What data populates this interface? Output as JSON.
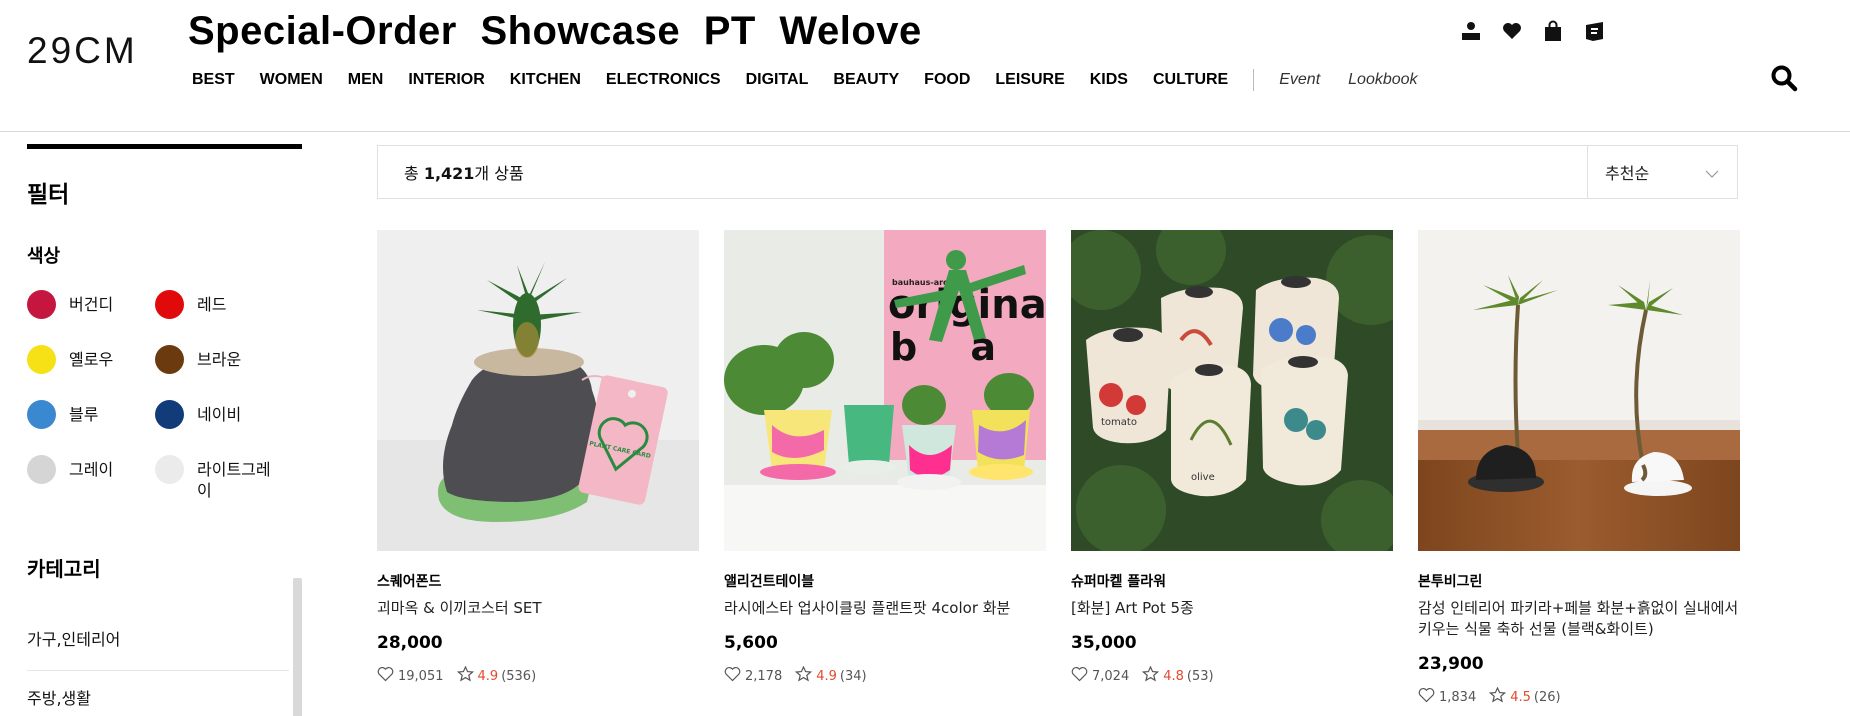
{
  "header": {
    "logo": "29CM",
    "headline": "Special-Order Showcase PT Welove",
    "nav": [
      "BEST",
      "WOMEN",
      "MEN",
      "INTERIOR",
      "KITCHEN",
      "ELECTRONICS",
      "DIGITAL",
      "BEAUTY",
      "FOOD",
      "LEISURE",
      "KIDS",
      "CULTURE"
    ],
    "sub_nav": [
      "Event",
      "Lookbook"
    ],
    "icons": [
      "user-icon",
      "heart-icon",
      "shopping-bag-icon",
      "notice-icon",
      "search-icon"
    ]
  },
  "sidebar": {
    "filter_title": "필터",
    "color_title": "색상",
    "colors": [
      {
        "label": "버건디",
        "hex": "#c4163f"
      },
      {
        "label": "레드",
        "hex": "#e00a0a"
      },
      {
        "label": "옐로우",
        "hex": "#f5e115"
      },
      {
        "label": "브라운",
        "hex": "#6b3a0f"
      },
      {
        "label": "블루",
        "hex": "#3a88d0"
      },
      {
        "label": "네이비",
        "hex": "#123b7a"
      },
      {
        "label": "그레이",
        "hex": "#d5d5d5"
      },
      {
        "label": "라이트그레이",
        "hex": "#ebebeb"
      }
    ],
    "category_title": "카테고리",
    "categories": [
      "가구,인테리어",
      "주방,생활"
    ]
  },
  "results": {
    "prefix": "총 ",
    "count": "1,421",
    "suffix": "개 상품",
    "sort_label": "추천순"
  },
  "products": [
    {
      "brand": "스퀘어폰드",
      "name": "괴마옥 & 이끼코스터 SET",
      "price": "28,000",
      "likes": "19,051",
      "rating": "4.9",
      "reviews": "(536)"
    },
    {
      "brand": "앨리건트테이블",
      "name": "라시에스타 업사이클링 플랜트팟 4color 화분",
      "price": "5,600",
      "likes": "2,178",
      "rating": "4.9",
      "reviews": "(34)"
    },
    {
      "brand": "슈퍼마켙 플라워",
      "name": "[화분] Art Pot 5종",
      "price": "35,000",
      "likes": "7,024",
      "rating": "4.8",
      "reviews": "(53)"
    },
    {
      "brand": "본투비그린",
      "name": "감성 인테리어 파키라+페블 화분+흙없이 실내에서 키우는 식물 축하 선물 (블랙&화이트)",
      "price": "23,900",
      "likes": "1,834",
      "rating": "4.5",
      "reviews": "(26)"
    }
  ],
  "image_texts": {
    "poster_line1": "original",
    "poster_line2": "b a u",
    "poster_header": "bauhaus-archiv",
    "plant_card": "PLANT CARE CARD",
    "pot_tomato": "tomato",
    "pot_olive": "olive"
  }
}
